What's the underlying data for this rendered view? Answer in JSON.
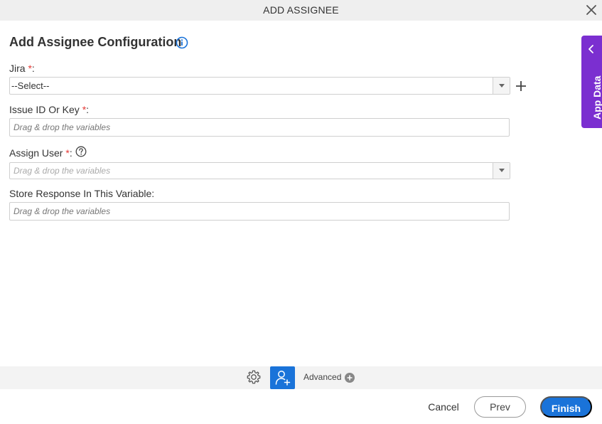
{
  "dialog": {
    "title": "ADD ASSIGNEE"
  },
  "form": {
    "heading": "Add Assignee Configuration",
    "jira": {
      "label": "Jira",
      "required_mark": "*",
      "colon": ":",
      "selected_value": "--Select--"
    },
    "issue": {
      "label": "Issue ID Or Key",
      "required_mark": "*",
      "colon": ":",
      "placeholder": "Drag & drop the variables"
    },
    "assign_user": {
      "label": "Assign User",
      "required_mark": "*",
      "colon": ":",
      "placeholder": "Drag & drop the variables"
    },
    "store_response": {
      "label": "Store Response In This Variable:",
      "placeholder": "Drag & drop the variables"
    }
  },
  "side_panel": {
    "label": "App Data"
  },
  "toolbar": {
    "advanced_label": "Advanced"
  },
  "footer": {
    "cancel_label": "Cancel",
    "prev_label": "Prev",
    "finish_label": "Finish"
  },
  "colors": {
    "accent_blue": "#1a73d9",
    "side_panel_purple": "#7b2fd0",
    "required_red": "#e53935"
  },
  "icons": {
    "close": "close-icon",
    "info": "info-icon",
    "add": "plus-icon",
    "help": "question-circle-icon",
    "settings": "gear-icon",
    "assignee": "add-user-icon",
    "advanced": "plus-circle-icon",
    "panel_toggle": "chevron-left-icon"
  }
}
